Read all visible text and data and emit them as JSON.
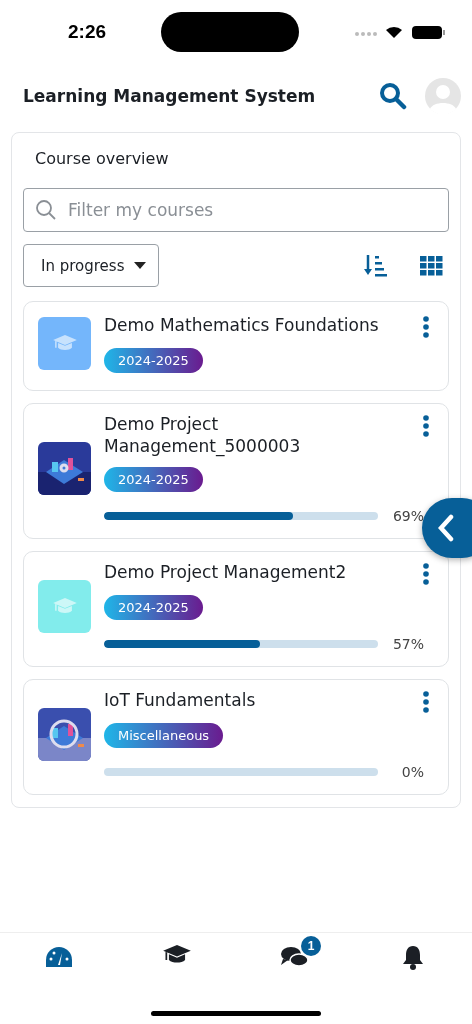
{
  "status_bar": {
    "time": "2:26"
  },
  "header": {
    "title": "Learning Management System"
  },
  "overview": {
    "title": "Course overview",
    "search": {
      "placeholder": "Filter my courses"
    },
    "filter": {
      "value": "In progress"
    },
    "courses": [
      {
        "title": "Demo Mathematics Foundations",
        "tag": "2024-2025",
        "thumbnail": {
          "kind": "placeholder",
          "color": "#74b6fb"
        }
      },
      {
        "title": "Demo Project Management_5000003",
        "tag": "2024-2025",
        "progress": {
          "level": 0.69,
          "reading": "69%"
        }
      },
      {
        "title": "Demo Project Management2",
        "tag": "2024-2025",
        "thumbnail": {
          "kind": "placeholder",
          "color": "#82ecec"
        },
        "progress": {
          "level": 0.57,
          "reading": "57%"
        }
      },
      {
        "title": "IoT Fundamentals",
        "tag": "Miscellaneous",
        "progress": {
          "level": 0,
          "reading": "0%"
        }
      }
    ]
  },
  "bottom_nav": [
    {
      "kind": "dashboard",
      "selected": true
    },
    {
      "kind": "courses",
      "selected": false
    },
    {
      "kind": "messages",
      "selected": false,
      "badge": "1"
    },
    {
      "kind": "notifications",
      "selected": false
    }
  ]
}
